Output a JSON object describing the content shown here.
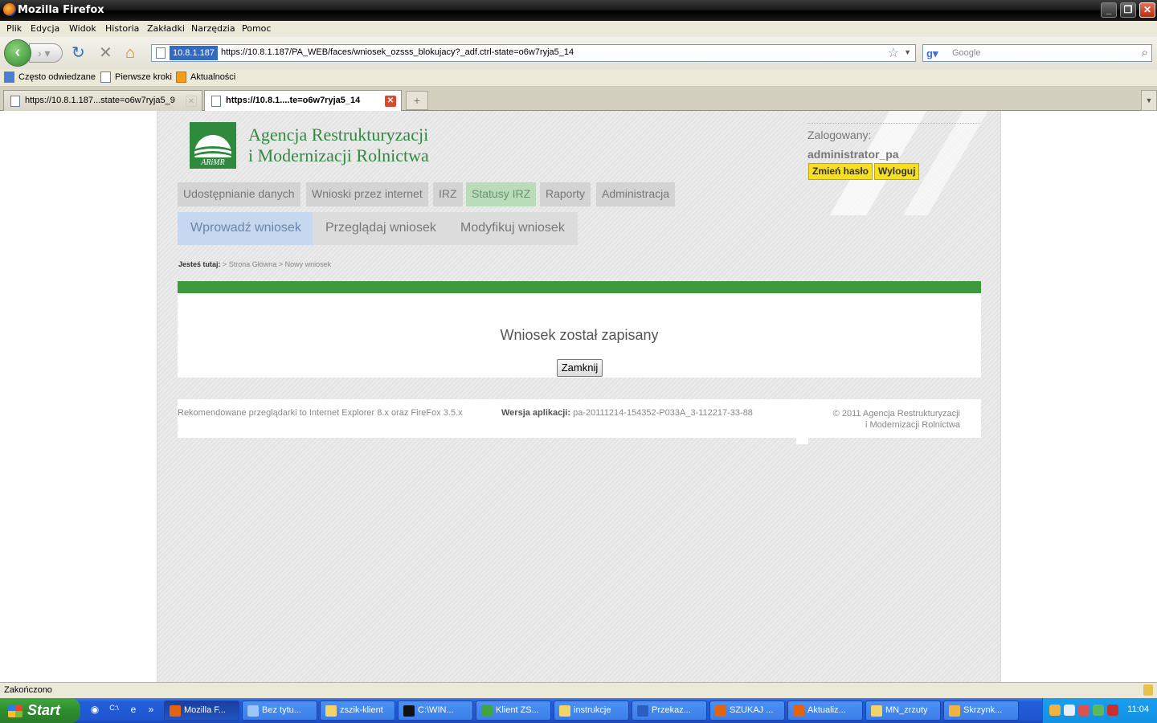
{
  "window": {
    "title": "Mozilla Firefox",
    "min": "_",
    "restore": "❐",
    "close": "✕"
  },
  "menu": [
    "Plik",
    "Edycja",
    "Widok",
    "Historia",
    "Zakładki",
    "Narzędzia",
    "Pomoc"
  ],
  "nav": {
    "site_identity": "10.8.1.187",
    "url": "https://10.8.1.187/PA_WEB/faces/wniosek_ozsss_blokujacy?_adf.ctrl-state=o6w7ryja5_14",
    "search_placeholder": "Google"
  },
  "bookmarks": [
    "Często odwiedzane",
    "Pierwsze kroki",
    "Aktualności"
  ],
  "tabs": [
    {
      "label": "https://10.8.1.187...state=o6w7ryja5_9",
      "active": false
    },
    {
      "label": "https://10.8.1....te=o6w7ryja5_14",
      "active": true
    }
  ],
  "header": {
    "agency_line1": "Agencja Restrukturyzacji",
    "agency_line2": "i Modernizacji Rolnictwa",
    "logo_text": "ARiMR",
    "logged_label": "Zalogowany:",
    "username": "administrator_pa",
    "change_password": "Zmień hasło",
    "logout": "Wyloguj"
  },
  "main_nav": [
    "Udostępnianie danych",
    "Wnioski przez internet",
    "IRZ",
    "Statusy IRZ",
    "Raporty",
    "Administracja"
  ],
  "main_nav_active": "Statusy IRZ",
  "sub_nav": [
    "Wprowadź wniosek",
    "Przeglądaj wniosek",
    "Modyfikuj wniosek"
  ],
  "sub_nav_active": "Wprowadź wniosek",
  "breadcrumb": {
    "label": "Jesteś tutaj:",
    "path": " > Strona Główna > Nowy wniosek"
  },
  "message": {
    "text": "Wniosek został zapisany",
    "close_button": "Zamknij"
  },
  "footer": {
    "browsers": "Rekomendowane przeglądarki to Internet Explorer 8.x oraz FireFox 3.5.x",
    "version_label": "Wersja aplikacji:",
    "version_value": " pa-20111214-154352-P033A_3-112217-33-88",
    "copyright_line1": "© 2011  Agencja Restrukturyzacji",
    "copyright_line2": "i Modernizacji Rolnictwa"
  },
  "status": {
    "text": "Zakończono"
  },
  "taskbar": {
    "start": "Start",
    "more": "»",
    "items": [
      "Mozilla F...",
      "Bez tytu...",
      "zszik-klient",
      "C:\\WIN...",
      "Klient ZS...",
      "instrukcje",
      "Przekaz...",
      "SZUKAJ ...",
      "Aktualiz...",
      "MN_zrzuty",
      "Skrzynk..."
    ],
    "clock": "11:04"
  },
  "colors": {
    "brand_green": "#2f8a3e",
    "message_bar": "#3c9a3c",
    "button_yellow": "#f5df1e"
  }
}
